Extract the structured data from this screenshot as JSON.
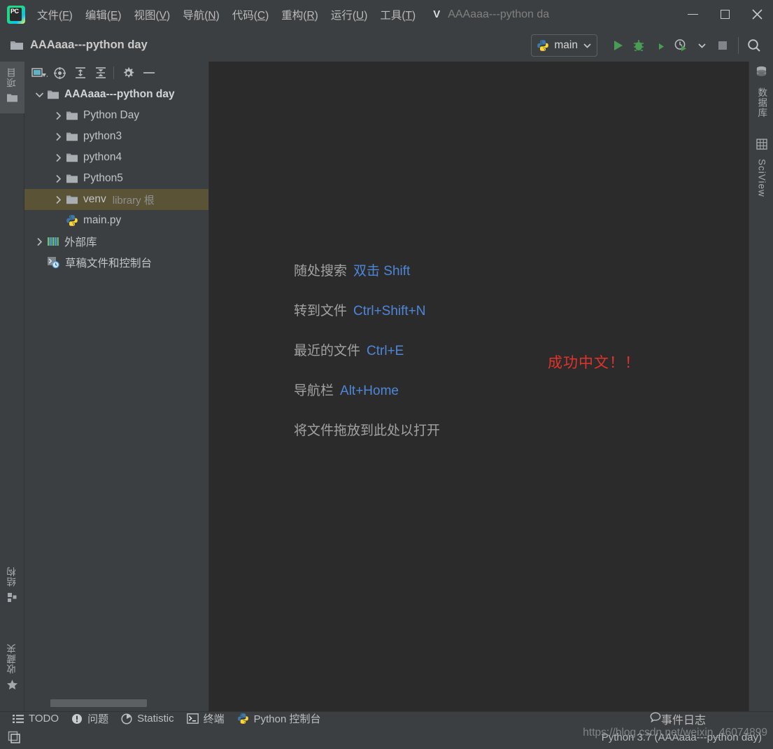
{
  "window": {
    "title": "AAAaaa---python da",
    "version_letter": "V",
    "minimize_label": "最小化",
    "maximize_label": "最大化",
    "close_label": "关闭"
  },
  "menubar": {
    "items": [
      {
        "label": "文件(F)",
        "text": "文件(",
        "mnemonic": "F",
        "tail": ")"
      },
      {
        "label": "编辑(E)",
        "text": "编辑(",
        "mnemonic": "E",
        "tail": ")"
      },
      {
        "label": "视图(V)",
        "text": "视图(",
        "mnemonic": "V",
        "tail": ")"
      },
      {
        "label": "导航(N)",
        "text": "导航(",
        "mnemonic": "N",
        "tail": ")"
      },
      {
        "label": "代码(C)",
        "text": "代码(",
        "mnemonic": "C",
        "tail": ")"
      },
      {
        "label": "重构(R)",
        "text": "重构(",
        "mnemonic": "R",
        "tail": ")"
      },
      {
        "label": "运行(U)",
        "text": "运行(",
        "mnemonic": "U",
        "tail": ")"
      },
      {
        "label": "工具(T)",
        "text": "工具(",
        "mnemonic": "T",
        "tail": ")"
      }
    ]
  },
  "toolbar": {
    "project_name": "AAAaaa---python day",
    "run_config": "main",
    "buttons": [
      {
        "name": "run-button",
        "label": "运行"
      },
      {
        "name": "debug-button",
        "label": "调试"
      },
      {
        "name": "run-coverage-button",
        "label": "运行覆盖率"
      },
      {
        "name": "profile-button",
        "label": "性能分析"
      },
      {
        "name": "stop-button",
        "label": "停止"
      },
      {
        "name": "search-everywhere-button",
        "label": "随处搜索"
      }
    ]
  },
  "project_panel": {
    "toolbar_icons": [
      {
        "name": "view-selector-icon",
        "label": "视图选择"
      },
      {
        "name": "locate-target-icon",
        "label": "定位到文件"
      },
      {
        "name": "expand-all-icon",
        "label": "全部展开"
      },
      {
        "name": "collapse-all-icon",
        "label": "全部折叠"
      },
      {
        "name": "settings-gear-icon",
        "label": "设置"
      },
      {
        "name": "hide-panel-icon",
        "label": "隐藏"
      }
    ],
    "tree": [
      {
        "label": "AAAaaa---python day",
        "indent": 0,
        "chevron": "down",
        "icon": "folder",
        "bold": true,
        "sub": "",
        "selected": false
      },
      {
        "label": "Python Day",
        "indent": 1,
        "chevron": "right",
        "icon": "folder",
        "bold": false,
        "sub": "",
        "selected": false
      },
      {
        "label": "python3",
        "indent": 1,
        "chevron": "right",
        "icon": "folder",
        "bold": false,
        "sub": "",
        "selected": false
      },
      {
        "label": "python4",
        "indent": 1,
        "chevron": "right",
        "icon": "folder",
        "bold": false,
        "sub": "",
        "selected": false
      },
      {
        "label": "Python5",
        "indent": 1,
        "chevron": "right",
        "icon": "folder",
        "bold": false,
        "sub": "",
        "selected": false
      },
      {
        "label": "venv",
        "indent": 1,
        "chevron": "right",
        "icon": "folder",
        "bold": false,
        "sub": "library 根",
        "selected": true
      },
      {
        "label": "main.py",
        "indent": 1,
        "chevron": "none",
        "icon": "python-file",
        "bold": false,
        "sub": "",
        "selected": false
      },
      {
        "label": "外部库",
        "indent": 0,
        "chevron": "right",
        "icon": "library",
        "bold": false,
        "sub": "",
        "selected": false
      },
      {
        "label": "草稿文件和控制台",
        "indent": 0,
        "chevron": "none",
        "icon": "scratch",
        "bold": false,
        "sub": "",
        "selected": false
      }
    ]
  },
  "editor": {
    "hints": [
      {
        "action": "随处搜索",
        "shortcut": "双击 Shift"
      },
      {
        "action": "转到文件",
        "shortcut": "Ctrl+Shift+N"
      },
      {
        "action": "最近的文件",
        "shortcut": "Ctrl+E"
      },
      {
        "action": "导航栏",
        "shortcut": "Alt+Home"
      },
      {
        "action": "将文件拖放到此处以打开",
        "shortcut": ""
      }
    ],
    "annotation": "成功中文！！",
    "annotation_color": "#e2332b"
  },
  "stripes": {
    "left_top": [
      {
        "name": "sidebar-item-project",
        "label": "项目",
        "icon": "project-icon"
      }
    ],
    "left_bottom": [
      {
        "name": "sidebar-item-structure",
        "label": "结构",
        "icon": "structure-icon"
      },
      {
        "name": "sidebar-item-favorites",
        "label": "收藏夹",
        "icon": "star-icon"
      }
    ],
    "right_top": [
      {
        "name": "sidebar-item-database",
        "label": "数据库",
        "icon": "database-icon"
      },
      {
        "name": "sidebar-item-sciview",
        "label": "SciView",
        "icon": "grid-icon"
      }
    ]
  },
  "toolwindow_bar": {
    "items": [
      {
        "label": "TODO",
        "icon": "todo-list-icon"
      },
      {
        "label": "问题",
        "icon": "warning-icon"
      },
      {
        "label": "Statistic",
        "icon": "pie-chart-icon"
      },
      {
        "label": "终端",
        "icon": "terminal-icon"
      },
      {
        "label": "Python 控制台",
        "icon": "python-icon"
      }
    ],
    "right_items": [
      {
        "label": "事件日志",
        "icon": "balloon-icon"
      }
    ]
  },
  "statusbar": {
    "left_icon": "layout-toggle-icon",
    "interpreter": "Python 3.7 (AAAaaa---python day)",
    "watermark": "https://blog.csdn.net/weixin_46074899"
  },
  "colors": {
    "accent_blue": "#4e87d8",
    "selection": "#5a5336",
    "editor_bg": "#2b2b2b",
    "chrome_bg": "#3c3f41",
    "green_run": "#59a869"
  }
}
